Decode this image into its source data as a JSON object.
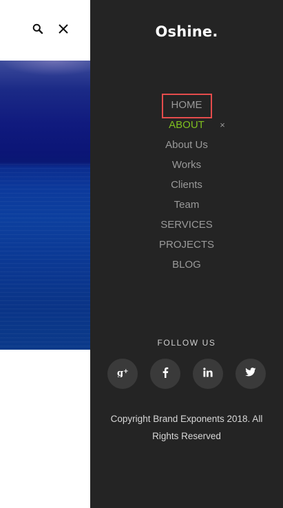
{
  "header": {
    "icons": [
      "search-icon",
      "close-icon"
    ]
  },
  "menu": {
    "logo": "Oshine.",
    "items": [
      {
        "label": "HOME",
        "state": "focused"
      },
      {
        "label": "ABOUT",
        "state": "active",
        "submenu_toggle": "×"
      },
      {
        "label": "About Us"
      },
      {
        "label": "Works"
      },
      {
        "label": "Clients"
      },
      {
        "label": "Team"
      },
      {
        "label": "SERVICES"
      },
      {
        "label": "PROJECTS"
      },
      {
        "label": "BLOG"
      }
    ]
  },
  "follow": {
    "title": "FOLLOW US",
    "networks": [
      {
        "icon": "google-plus-icon",
        "glyph": "g+"
      },
      {
        "icon": "facebook-icon",
        "glyph": "f"
      },
      {
        "icon": "linkedin-icon",
        "glyph": "in"
      },
      {
        "icon": "twitter-icon",
        "glyph": "twitter"
      }
    ]
  },
  "footer": {
    "copyright": "Copyright Brand Exponents 2018. All Rights Reserved"
  },
  "colors": {
    "panel_bg": "#242424",
    "active": "#7fbf1f",
    "focus_outline": "#e54c4c",
    "menu_text": "#9a9a9a"
  }
}
